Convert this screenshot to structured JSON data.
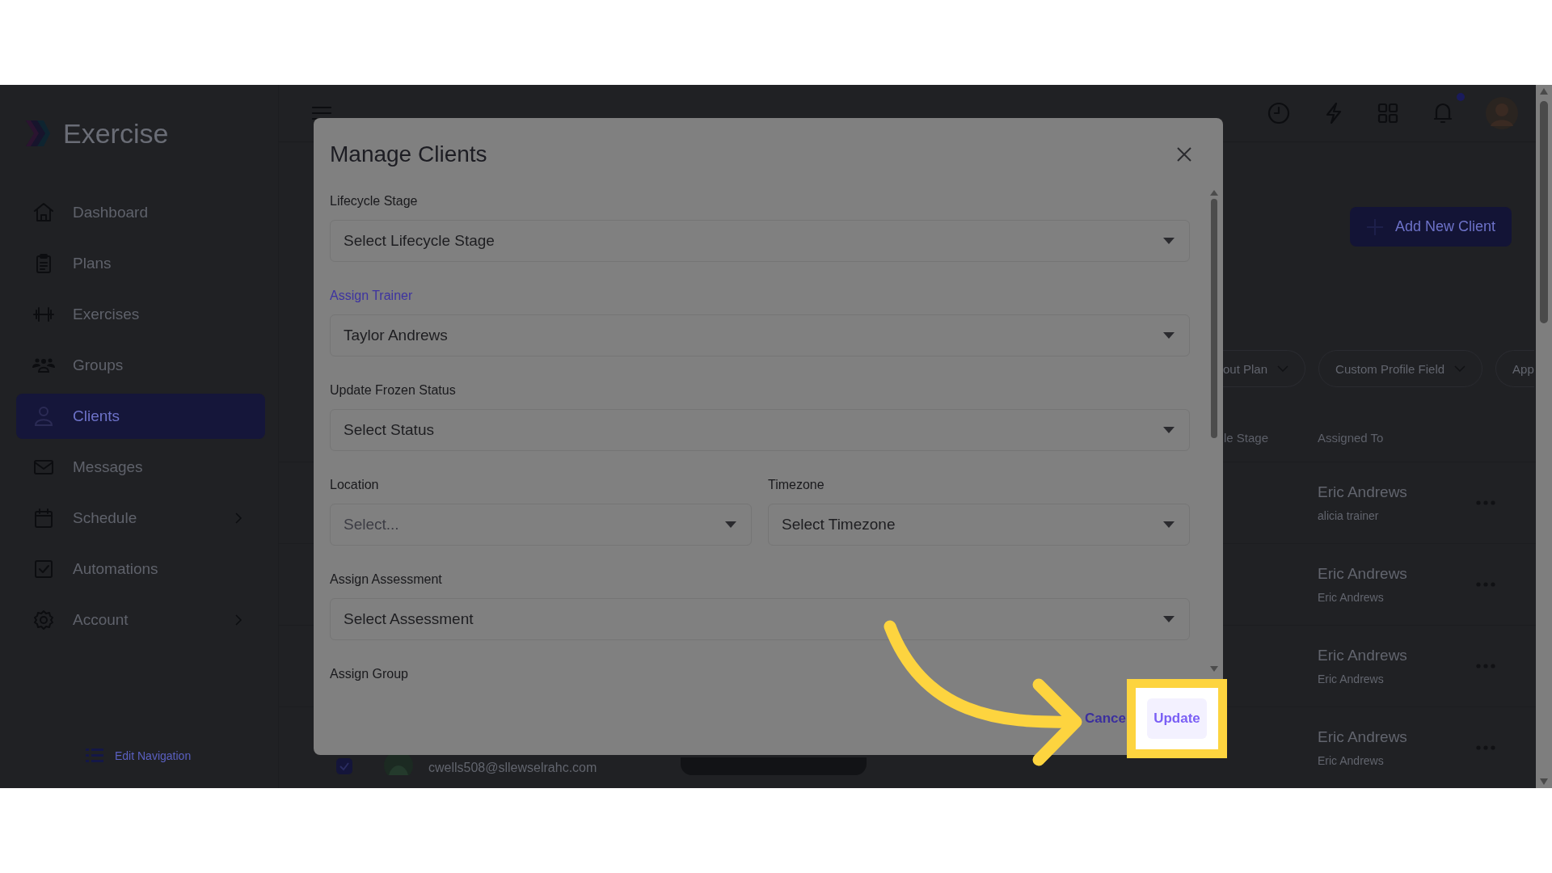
{
  "app": {
    "logo": "Exercise"
  },
  "sidebar": {
    "items": [
      {
        "label": "Dashboard",
        "selected": false,
        "expandable": false
      },
      {
        "label": "Plans",
        "selected": false,
        "expandable": false
      },
      {
        "label": "Exercises",
        "selected": false,
        "expandable": false
      },
      {
        "label": "Groups",
        "selected": false,
        "expandable": false
      },
      {
        "label": "Clients",
        "selected": true,
        "expandable": false
      },
      {
        "label": "Messages",
        "selected": false,
        "expandable": false
      },
      {
        "label": "Schedule",
        "selected": false,
        "expandable": true
      },
      {
        "label": "Automations",
        "selected": false,
        "expandable": false
      },
      {
        "label": "Account",
        "selected": false,
        "expandable": true
      }
    ],
    "edit_navigation": "Edit Navigation"
  },
  "header": {
    "unread_notifications": true
  },
  "page": {
    "add_button": "Add New Client",
    "filters": [
      "out Plan",
      "Custom Profile Field",
      "App"
    ],
    "columns": [
      "le Stage",
      "Assigned To"
    ],
    "rows": [
      {
        "assigned": "Eric Andrews",
        "assigned_by": "alicia trainer"
      },
      {
        "assigned": "Eric Andrews",
        "assigned_by": "Eric Andrews"
      },
      {
        "assigned": "Eric Andrews",
        "assigned_by": "Eric Andrews"
      },
      {
        "assigned": "Eric Andrews",
        "assigned_by": "Eric Andrews",
        "checked": true,
        "email": "cwells508@sllewselrahc.com"
      }
    ]
  },
  "modal": {
    "title": "Manage Clients",
    "fields": [
      [
        {
          "label": "Lifecycle Stage",
          "value": "Select Lifecycle Stage",
          "focused": false
        }
      ],
      [
        {
          "label": "Assign Trainer",
          "value": "Taylor Andrews",
          "focused": true
        }
      ],
      [
        {
          "label": "Update Frozen Status",
          "value": "Select Status",
          "focused": false
        }
      ],
      [
        {
          "label": "Location",
          "placeholder": "Select...",
          "focused": false
        },
        {
          "label": "Timezone",
          "value": "Select Timezone",
          "focused": false
        }
      ],
      [
        {
          "label": "Assign Assessment",
          "value": "Select Assessment",
          "focused": false
        }
      ],
      [
        {
          "label": "Assign Group",
          "focused": false
        }
      ]
    ],
    "cancel": "Cance",
    "update": "Update"
  },
  "annotation": {
    "arrow": true,
    "highlight": true
  }
}
